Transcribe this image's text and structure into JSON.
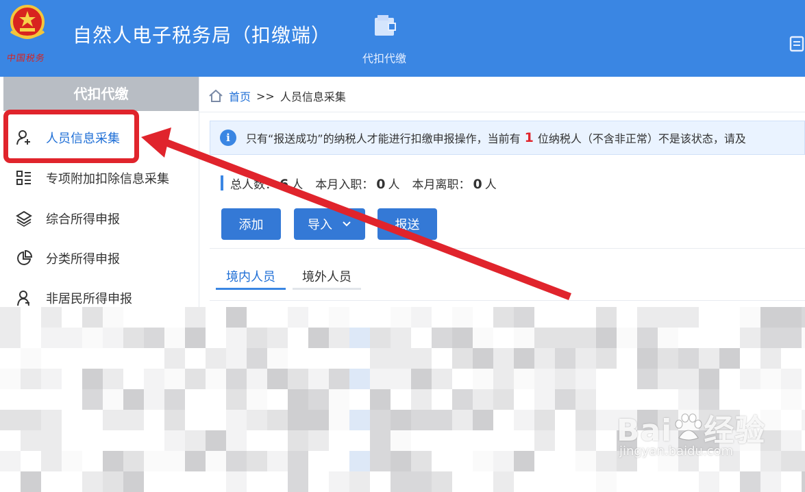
{
  "header": {
    "emblem_text": "中国税务",
    "title": "自然人电子税务局（扣缴端）",
    "nav_item_label": "代扣代缴"
  },
  "sidebar": {
    "title": "代扣代缴",
    "items": [
      {
        "label": "人员信息采集",
        "icon": "person-add-icon",
        "active": true
      },
      {
        "label": "专项附加扣除信息采集",
        "icon": "list-grid-icon",
        "active": false
      },
      {
        "label": "综合所得申报",
        "icon": "layers-icon",
        "active": false
      },
      {
        "label": "分类所得申报",
        "icon": "pie-chart-icon",
        "active": false
      },
      {
        "label": "非居民所得申报",
        "icon": "person-icon",
        "active": false
      }
    ]
  },
  "breadcrumb": {
    "home": "首页",
    "separator": ">>",
    "current": "人员信息采集"
  },
  "notice": {
    "prefix": "只有“报送成功”的纳税人才能进行扣缴申报操作，当前有",
    "count": "1",
    "suffix": "位纳税人（不含非正常）不是该状态，请及"
  },
  "stats": {
    "total_label": "总人数：",
    "total_value": "6",
    "unit": "人",
    "joined_label": "本月入职：",
    "joined_value": "0",
    "left_label": "本月离职：",
    "left_value": "0"
  },
  "toolbar": {
    "add_label": "添加",
    "import_label": "导入",
    "submit_label": "报送"
  },
  "tabs": [
    {
      "label": "境内人员",
      "active": true
    },
    {
      "label": "境外人员",
      "active": false
    }
  ],
  "watermark": {
    "brand": "Bai",
    "brand_tail": "经验",
    "url": "jingyan.baidu.com"
  },
  "colors": {
    "header_bg": "#3a86e3",
    "accent": "#1f6fd6",
    "highlight_red": "#e0242c"
  }
}
